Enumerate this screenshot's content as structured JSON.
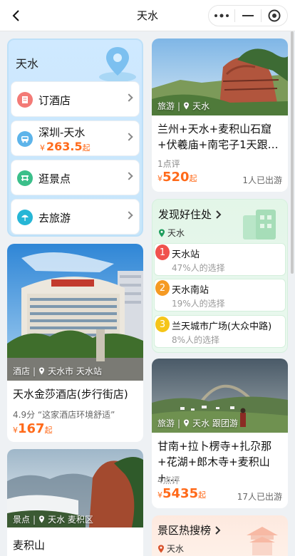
{
  "nav": {
    "title": "天水"
  },
  "city_card": {
    "title": "天水",
    "items": [
      {
        "label": "订酒店"
      },
      {
        "label": "深圳-天水",
        "currency": "¥",
        "price": "263.5",
        "suffix": "起"
      },
      {
        "label": "逛景点"
      },
      {
        "label": "去旅游"
      }
    ]
  },
  "tour_card_1": {
    "category": "旅游",
    "location": "天水",
    "title": "兰州+天水+麦积山石窟+伏羲庙+南宅子1天跟…",
    "reviews": "1点评",
    "currency": "¥",
    "price": "520",
    "suffix": "起",
    "went": "1人已出游"
  },
  "stay_card": {
    "title": "发现好住处",
    "location": "天水",
    "items": [
      {
        "rank": "1",
        "name": "天水站",
        "pct": "47%人的选择",
        "color": "#f0524d"
      },
      {
        "rank": "2",
        "name": "天水南站",
        "pct": "19%人的选择",
        "color": "#f59a23"
      },
      {
        "rank": "3",
        "name": "兰天城市广场(大众中路)",
        "pct": "8%人的选择",
        "color": "#f5c518"
      }
    ]
  },
  "hotel_card": {
    "category": "酒店",
    "location": "天水市 天水站",
    "title": "天水金莎酒店(步行街店)",
    "score": "4.9分",
    "quote": "“这家酒店环境舒适”",
    "currency": "¥",
    "price": "167",
    "suffix": "起"
  },
  "tour_card_2": {
    "category": "旅游",
    "location": "天水 跟团游",
    "title": "甘南+拉卜楞寺+扎尕那+花湖+郎木寺+麦积山+…",
    "reviews": "4点评",
    "currency": "¥",
    "price": "5435",
    "suffix": "起",
    "went": "17人已出游"
  },
  "sight_card": {
    "category": "景点",
    "location": "天水 麦积区",
    "title": "麦积山"
  },
  "hot_card": {
    "title": "景区热搜榜",
    "location": "天水"
  },
  "colors": {
    "accent_price": "#ff6a1a",
    "stay_bg": "#e3f6e8",
    "city_bg": "#cfe9ff"
  }
}
